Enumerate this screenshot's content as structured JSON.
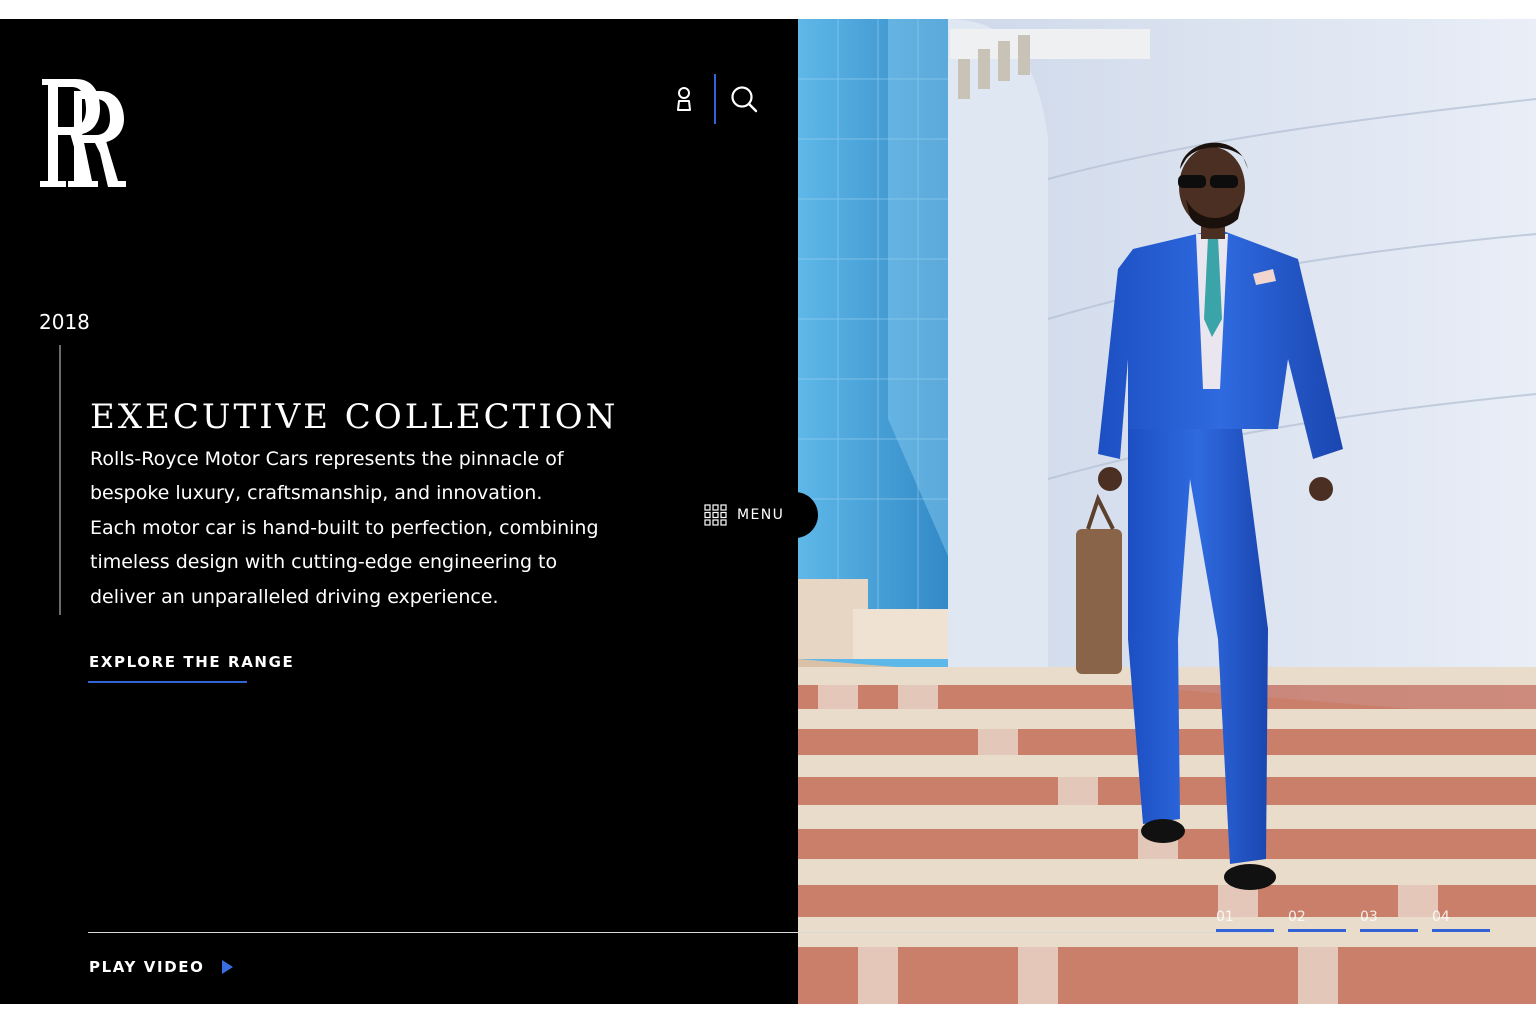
{
  "header": {
    "account_icon": "user-icon",
    "search_icon": "search-icon",
    "accent_color": "#3463d6"
  },
  "hero": {
    "year": "2018",
    "title": "EXECUTIVE COLLECTION",
    "description_lines": [
      "Rolls-Royce Motor Cars represents the pinnacle of",
      "bespoke luxury, craftsmanship, and innovation.",
      "Each motor car is hand-built to perfection, combining",
      "timeless design with cutting-edge engineering to",
      "deliver an unparalleled driving experience."
    ],
    "cta_label": "EXPLORE THE RANGE"
  },
  "menu": {
    "label": "MENU",
    "icon": "grid-icon"
  },
  "footer": {
    "play_label": "PLAY VIDEO",
    "play_icon": "play-icon"
  },
  "pager": {
    "items": [
      "01",
      "02",
      "03",
      "04"
    ]
  }
}
